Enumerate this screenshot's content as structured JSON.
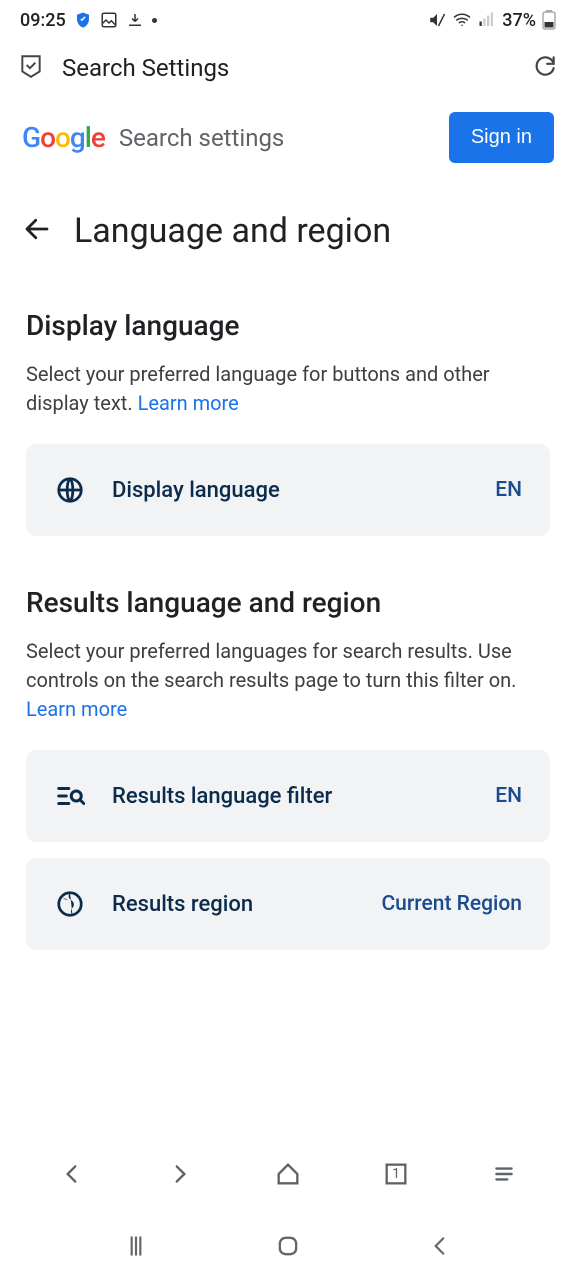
{
  "status": {
    "time": "09:25",
    "battery": "37%"
  },
  "appHeader": {
    "title": "Search Settings"
  },
  "googleBar": {
    "sub": "Search settings",
    "signin": "Sign in"
  },
  "pageTitle": "Language and region",
  "display": {
    "title": "Display language",
    "desc": "Select your preferred language for buttons and other display text. ",
    "learn": "Learn more",
    "card": {
      "label": "Display language",
      "value": "EN"
    }
  },
  "results": {
    "title": "Results language and region",
    "desc": "Select your preferred languages for search results. Use controls on the search results page to turn this filter on. ",
    "learn": "Learn more",
    "card1": {
      "label": "Results language filter",
      "value": "EN"
    },
    "card2": {
      "label": "Results region",
      "value": "Current Region"
    }
  },
  "browserNav": {
    "tabCount": "1"
  }
}
